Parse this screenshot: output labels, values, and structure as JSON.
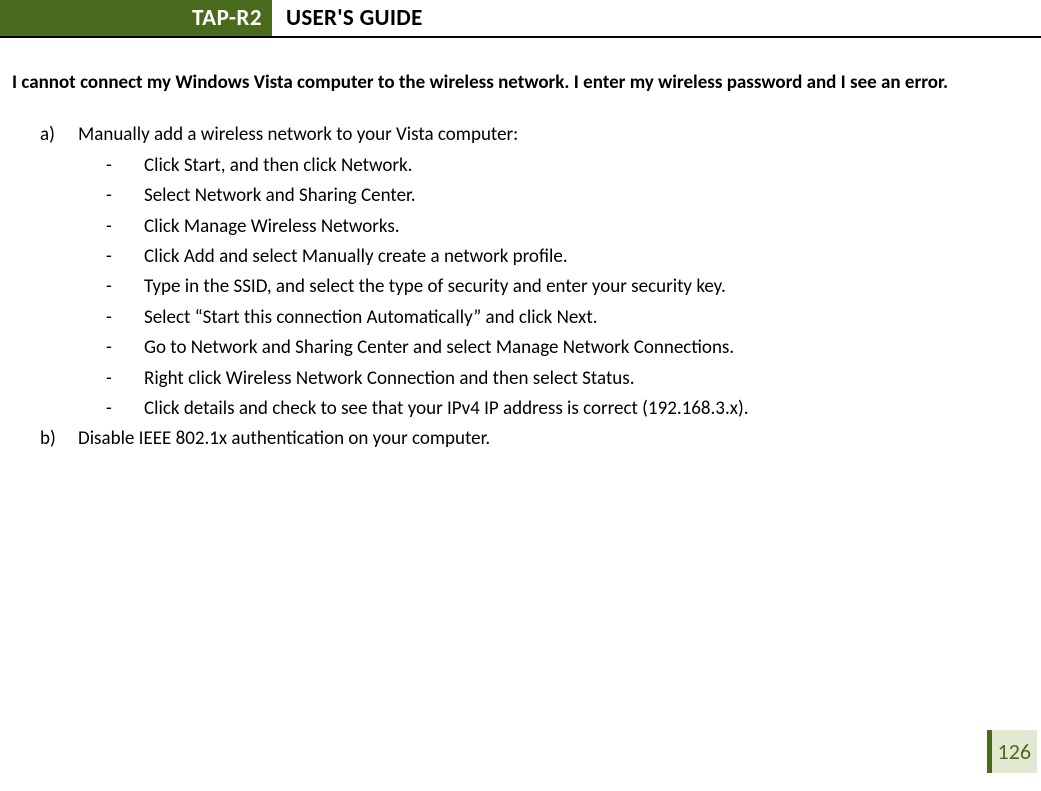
{
  "header": {
    "badge": "TAP-R2",
    "title": "USER'S GUIDE"
  },
  "question": "I cannot connect my Windows Vista computer to the wireless network.  I enter my wireless password and I see an error.",
  "items": [
    {
      "marker": "a)",
      "text": "Manually add a wireless network to your Vista computer:",
      "subitems": [
        "Click Start, and then click Network.",
        "Select Network and Sharing Center.",
        "Click Manage Wireless Networks.",
        "Click Add and select Manually create a network profile.",
        "Type in the SSID, and select the type of security and enter your security key.",
        "Select “Start this connection Automatically” and click Next.",
        "Go to Network and Sharing Center and select Manage Network Connections.",
        "Right click Wireless Network Connection and then select Status.",
        "Click details and check to see that your IPv4 IP address is correct (192.168.3.x)."
      ]
    },
    {
      "marker": "b)",
      "text": "Disable IEEE 802.1x authentication on your computer.",
      "subitems": []
    }
  ],
  "subMarker": "-",
  "pageNumber": "126"
}
